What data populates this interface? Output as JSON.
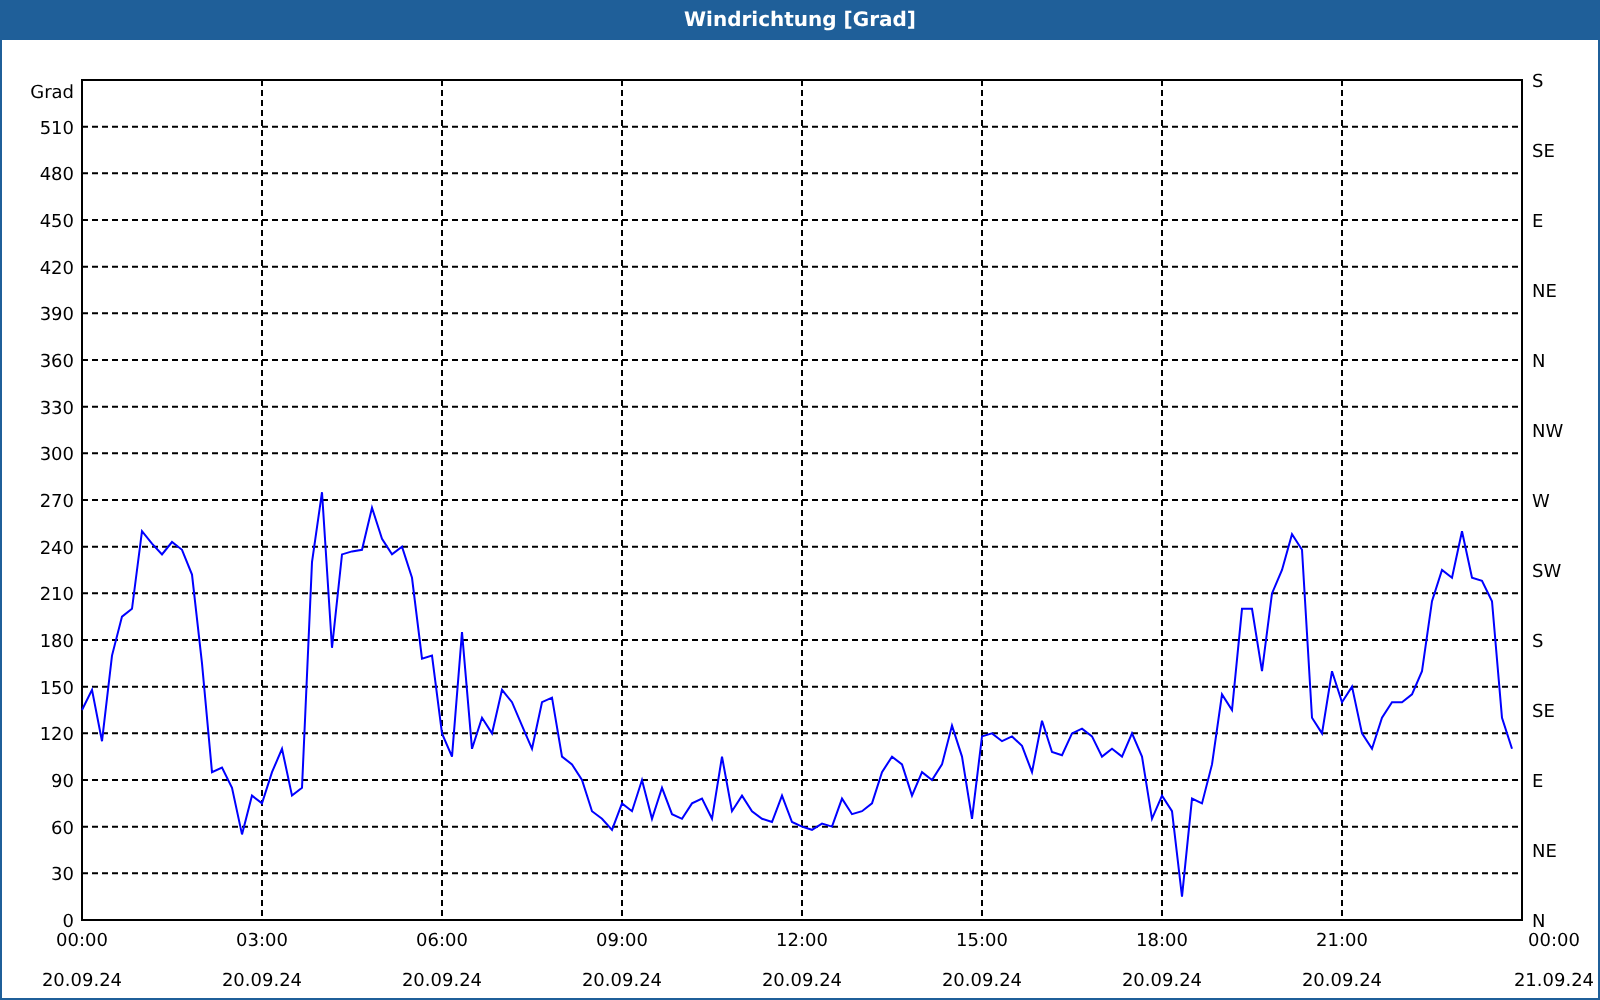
{
  "window": {
    "title": "Windrichtung [Grad]"
  },
  "chart": {
    "chart_data": {
      "type": "line",
      "ylabel": "Grad",
      "xlim": [
        0,
        1440
      ],
      "ylim": [
        0,
        540
      ],
      "x": [
        0,
        10,
        20,
        30,
        40,
        50,
        60,
        70,
        80,
        90,
        100,
        110,
        120,
        130,
        140,
        150,
        160,
        170,
        180,
        190,
        200,
        210,
        220,
        230,
        240,
        250,
        260,
        270,
        280,
        290,
        300,
        310,
        320,
        330,
        340,
        350,
        360,
        370,
        380,
        390,
        400,
        410,
        420,
        430,
        440,
        450,
        460,
        470,
        480,
        490,
        500,
        510,
        520,
        530,
        540,
        550,
        560,
        570,
        580,
        590,
        600,
        610,
        620,
        630,
        640,
        650,
        660,
        670,
        680,
        690,
        700,
        710,
        720,
        730,
        740,
        750,
        760,
        770,
        780,
        790,
        800,
        810,
        820,
        830,
        840,
        850,
        860,
        870,
        880,
        890,
        900,
        910,
        920,
        930,
        940,
        950,
        960,
        970,
        980,
        990,
        1000,
        1010,
        1020,
        1030,
        1040,
        1050,
        1060,
        1070,
        1080,
        1090,
        1100,
        1110,
        1120,
        1130,
        1140,
        1150,
        1160,
        1170,
        1180,
        1190,
        1200,
        1210,
        1220,
        1230,
        1240,
        1250,
        1260,
        1270,
        1280,
        1290,
        1300,
        1310,
        1320,
        1330,
        1340,
        1350,
        1360,
        1370,
        1380,
        1390,
        1400,
        1410,
        1420,
        1430
      ],
      "series": [
        {
          "color": "#0000ff",
          "values": [
            135,
            148,
            115,
            170,
            195,
            200,
            250,
            242,
            235,
            243,
            238,
            222,
            165,
            95,
            98,
            85,
            55,
            80,
            75,
            95,
            110,
            80,
            85,
            230,
            275,
            175,
            235,
            237,
            238,
            265,
            245,
            235,
            240,
            220,
            168,
            170,
            120,
            105,
            185,
            110,
            130,
            120,
            148,
            140,
            125,
            110,
            140,
            143,
            105,
            100,
            90,
            70,
            65,
            58,
            75,
            70,
            90,
            65,
            85,
            68,
            65,
            75,
            78,
            65,
            105,
            70,
            80,
            70,
            65,
            63,
            80,
            63,
            60,
            58,
            62,
            60,
            78,
            68,
            70,
            75,
            95,
            105,
            100,
            80,
            95,
            90,
            100,
            125,
            105,
            65,
            118,
            120,
            115,
            118,
            112,
            95,
            128,
            108,
            106,
            120,
            123,
            118,
            105,
            110,
            105,
            120,
            105,
            65,
            80,
            70,
            15,
            78,
            75,
            100,
            145,
            135,
            200,
            200,
            160,
            210,
            225,
            248,
            238,
            130,
            120,
            160,
            140,
            150,
            120,
            110,
            130,
            140,
            140,
            145,
            160,
            205,
            225,
            220,
            250,
            220,
            218,
            205,
            130,
            110
          ]
        }
      ],
      "xticks": [
        {
          "value": 0,
          "label": "00:00"
        },
        {
          "value": 180,
          "label": "03:00"
        },
        {
          "value": 360,
          "label": "06:00"
        },
        {
          "value": 540,
          "label": "09:00"
        },
        {
          "value": 720,
          "label": "12:00"
        },
        {
          "value": 900,
          "label": "15:00"
        },
        {
          "value": 1080,
          "label": "18:00"
        },
        {
          "value": 1260,
          "label": "21:00"
        }
      ],
      "yticks": [
        0,
        30,
        60,
        90,
        120,
        150,
        180,
        210,
        240,
        270,
        300,
        330,
        360,
        390,
        420,
        450,
        480,
        510
      ],
      "grid": true
    },
    "xtick_dates": [
      "20.09.24",
      "20.09.24",
      "20.09.24",
      "20.09.24",
      "20.09.24",
      "20.09.24",
      "20.09.24",
      "20.09.24"
    ],
    "end_tick": {
      "time": "00:00",
      "date": "21.09.24"
    },
    "right_axis": [
      "S",
      "SE",
      "E",
      "NE",
      "N",
      "NW",
      "W",
      "SW",
      "S",
      "SE",
      "E",
      "NE",
      "N"
    ]
  }
}
